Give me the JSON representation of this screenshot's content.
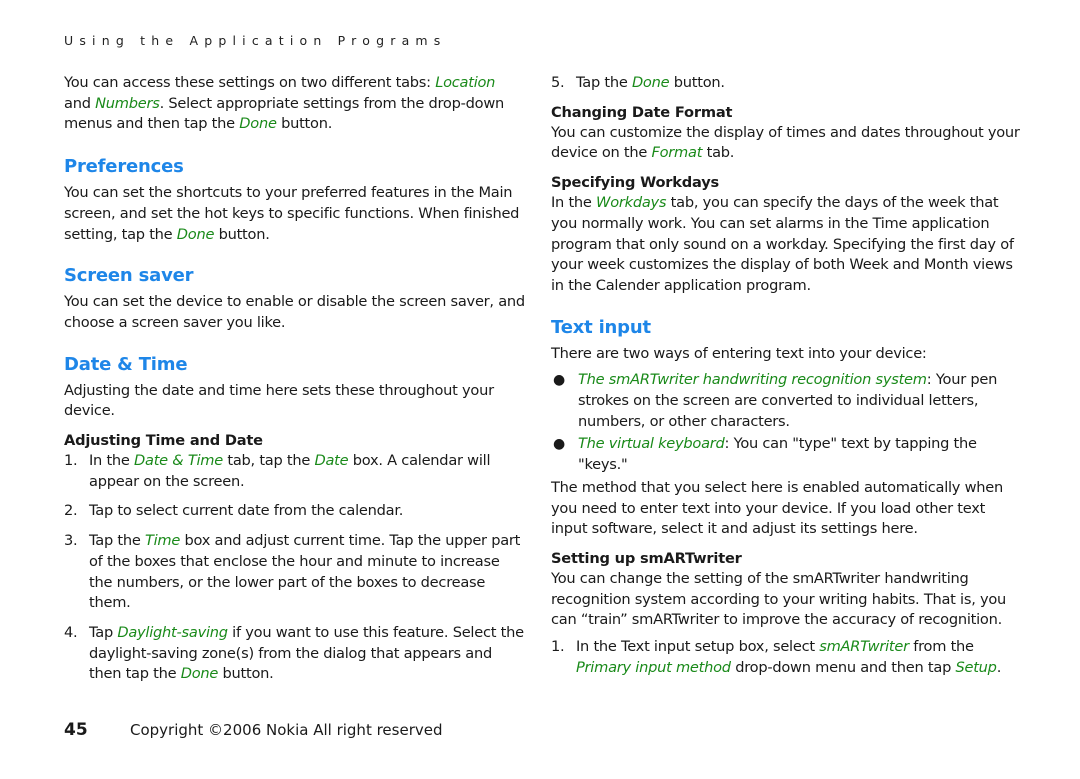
{
  "running_head": "Using the Application Programs",
  "left": {
    "intro": {
      "t1": "You can access these settings on two different tabs: ",
      "location": "Location",
      "t2": " and ",
      "numbers": "Numbers",
      "t3": ". Select appropriate settings from the drop-down menus and then tap the ",
      "done": "Done",
      "t4": " button."
    },
    "preferences": {
      "heading": "Preferences",
      "t1": "You can set the shortcuts to your preferred features in the Main screen, and set the hot keys to specific functions. When finished setting, tap the ",
      "done": "Done",
      "t2": " button."
    },
    "screen_saver": {
      "heading": "Screen saver",
      "body": "You can set the device to enable or disable the screen saver, and choose a screen saver you like."
    },
    "date_time": {
      "heading": "Date & Time",
      "body": "Adjusting the date and time here sets these throughout your device.",
      "subheading": "Adjusting Time and Date",
      "steps": [
        {
          "num": "1.",
          "t1": "In the ",
          "g1": "Date & Time",
          "t2": " tab, tap the ",
          "g2": "Date",
          "t3": " box. A calendar will appear on the screen."
        },
        {
          "num": "2.",
          "t1": "Tap to select current date from the calendar."
        },
        {
          "num": "3.",
          "t1": "Tap the ",
          "g1": "Time",
          "t2": " box and adjust current time. Tap the upper part of the boxes that enclose the hour and minute to increase the numbers, or the lower part of the boxes to decrease them."
        },
        {
          "num": "4.",
          "t1": "Tap ",
          "g1": "Daylight-saving",
          "t2": " if you want to use this feature. Select the daylight-saving zone(s) from the dialog that appears and then tap the ",
          "g2": "Done",
          "t3": " button."
        }
      ]
    }
  },
  "right": {
    "step5": {
      "num": "5.",
      "t1": "Tap the ",
      "g1": "Done",
      "t2": " button."
    },
    "changing_format": {
      "subheading": "Changing Date Format",
      "t1": "You can customize the display of times and dates throughout your device on the ",
      "g1": "Format",
      "t2": " tab."
    },
    "workdays": {
      "subheading": "Specifying Workdays",
      "t1": "In the ",
      "g1": "Workdays",
      "t2": " tab, you can specify the days of the week that you normally work. You can set alarms in the Time application program that only sound on a workday. Specifying the first day of your week customizes the display of both Week and Month views in the Calender application program."
    },
    "text_input": {
      "heading": "Text input",
      "intro": "There are two ways of entering text into your device:",
      "bullets": [
        {
          "g1": "The smARTwriter handwriting recognition system",
          "t1": ": Your pen strokes on the screen are converted to individual letters, numbers, or other characters."
        },
        {
          "g1": "The virtual keyboard",
          "t1": ": You can \"type\" text by tapping the \"keys.\""
        }
      ],
      "body": "The method that you select here is enabled automatically when you need to enter text into your device. If you load other text input software, select it and adjust its settings here."
    },
    "setup_smartwriter": {
      "subheading": "Setting up smARTwriter",
      "body": "You can change the setting of the smARTwriter handwriting recognition system according to your writing habits. That is, you can “train” smARTwriter to improve the accuracy of recognition.",
      "steps": [
        {
          "num": "1.",
          "t1": "In the Text input setup box, select ",
          "g1": "smARTwriter",
          "t2": " from the ",
          "g2": "Primary input method",
          "t3": " drop-down menu and then tap ",
          "g3": "Setup",
          "t4": "."
        }
      ]
    }
  },
  "footer": {
    "page_number": "45",
    "copyright": "Copyright ©2006 Nokia All right reserved"
  },
  "colors": {
    "heading": "#1e86e8",
    "emphasis": "#1a8a1a",
    "text": "#1a1a1a"
  }
}
